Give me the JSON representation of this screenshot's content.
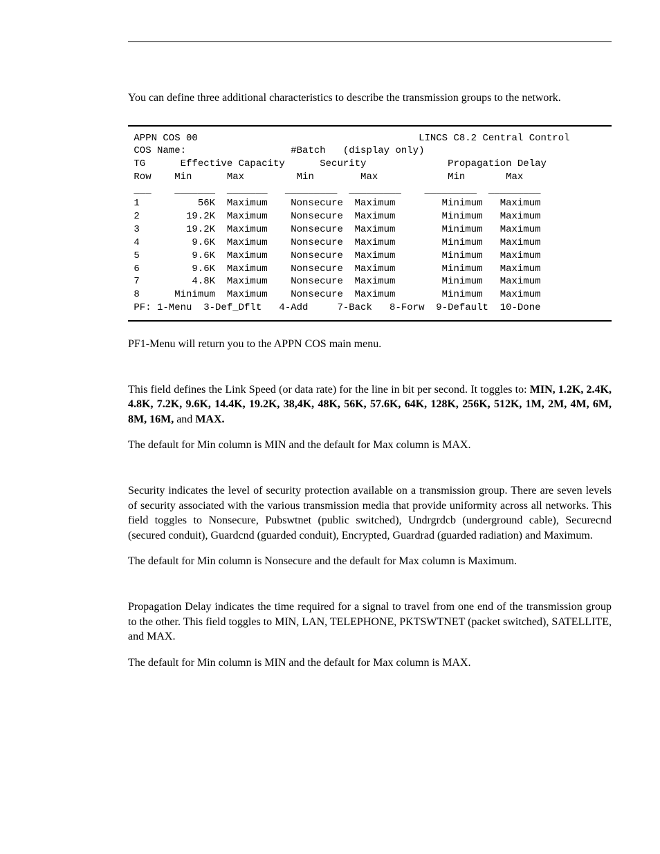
{
  "intro": "You can define three additional characteristics to describe the transmission groups to the network.",
  "terminal": {
    "header_left": "APPN COS 00",
    "header_right": "LINCS C8.2 Central Control",
    "cos_name_label": "COS Name:",
    "cos_name_value": "#Batch",
    "cos_name_note": "(display only)",
    "group_headers": {
      "tg": "TG",
      "eff_cap": "Effective Capacity",
      "security": "Security",
      "prop_delay": "Propagation Delay"
    },
    "col_headers": {
      "row": "Row",
      "min": "Min",
      "max": "Max"
    },
    "rows": [
      {
        "n": "1",
        "ec_min": "56K",
        "ec_max": "Maximum",
        "sec_min": "Nonsecure",
        "sec_max": "Maximum",
        "pd_min": "Minimum",
        "pd_max": "Maximum"
      },
      {
        "n": "2",
        "ec_min": "19.2K",
        "ec_max": "Maximum",
        "sec_min": "Nonsecure",
        "sec_max": "Maximum",
        "pd_min": "Minimum",
        "pd_max": "Maximum"
      },
      {
        "n": "3",
        "ec_min": "19.2K",
        "ec_max": "Maximum",
        "sec_min": "Nonsecure",
        "sec_max": "Maximum",
        "pd_min": "Minimum",
        "pd_max": "Maximum"
      },
      {
        "n": "4",
        "ec_min": "9.6K",
        "ec_max": "Maximum",
        "sec_min": "Nonsecure",
        "sec_max": "Maximum",
        "pd_min": "Minimum",
        "pd_max": "Maximum"
      },
      {
        "n": "5",
        "ec_min": "9.6K",
        "ec_max": "Maximum",
        "sec_min": "Nonsecure",
        "sec_max": "Maximum",
        "pd_min": "Minimum",
        "pd_max": "Maximum"
      },
      {
        "n": "6",
        "ec_min": "9.6K",
        "ec_max": "Maximum",
        "sec_min": "Nonsecure",
        "sec_max": "Maximum",
        "pd_min": "Minimum",
        "pd_max": "Maximum"
      },
      {
        "n": "7",
        "ec_min": "4.8K",
        "ec_max": "Maximum",
        "sec_min": "Nonsecure",
        "sec_max": "Maximum",
        "pd_min": "Minimum",
        "pd_max": "Maximum"
      },
      {
        "n": "8",
        "ec_min": "Minimum",
        "ec_max": "Maximum",
        "sec_min": "Nonsecure",
        "sec_max": "Maximum",
        "pd_min": "Minimum",
        "pd_max": "Maximum"
      }
    ],
    "pf_line": "PF: 1-Menu  3-Def_Dflt   4-Add     7-Back   8-Forw  9-Default  10-Done"
  },
  "pf1_note": "PF1-Menu will return you to the APPN COS main menu.",
  "linkspeed_p1_a": "This field defines the Link Speed (or data rate) for the line in bit per second. It toggles to: ",
  "linkspeed_p1_b": "MIN, 1.2K, 2.4K, 4.8K, 7.2K, 9.6K, 14.4K, 19.2K, 38,4K, 48K, 56K, 57.6K, 64K, 128K, 256K, 512K, 1M, 2M, 4M, 6M, 8M, 16M,",
  "linkspeed_p1_c": " and ",
  "linkspeed_p1_d": "MAX.",
  "linkspeed_p2": "The default for Min column is MIN and the default for Max column is MAX.",
  "security_p1": "Security indicates the level of security protection available on a transmission group. There are seven levels of security associated with the various transmission media that provide uniformity across all networks. This field toggles to Nonsecure, Pubswtnet (public switched), Undrgrdcb (underground cable), Securecnd (secured conduit), Guardcnd (guarded conduit), Encrypted, Guardrad (guarded radiation) and Maximum.",
  "security_p2": "The default for Min column is Nonsecure and the default for Max column is Maximum.",
  "propdelay_p1": "Propagation Delay indicates the time required for a signal to travel from one end of the transmission group to the other. This field toggles to MIN, LAN, TELEPHONE, PKTSWTNET (packet switched), SATELLITE, and MAX.",
  "propdelay_p2": "The default for Min column is MIN and the default for Max column is MAX."
}
